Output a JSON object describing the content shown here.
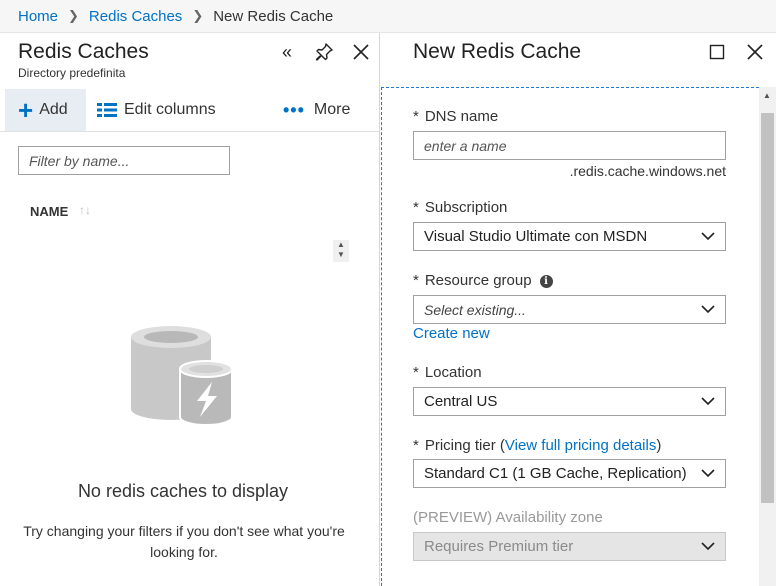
{
  "breadcrumb": {
    "items": [
      "Home",
      "Redis Caches"
    ],
    "current": "New Redis Cache"
  },
  "left_blade": {
    "title": "Redis Caches",
    "subtitle": "Directory predefinita",
    "toolbar": {
      "add_label": "Add",
      "edit_columns_label": "Edit columns",
      "more_label": "More"
    },
    "filter_placeholder": "Filter by name...",
    "column_header": "NAME",
    "empty_title": "No redis caches to display",
    "empty_subtitle": "Try changing your filters if you don't see what you're looking for."
  },
  "right_blade": {
    "title": "New Redis Cache",
    "dns": {
      "label": "DNS name",
      "placeholder": "enter a name",
      "suffix": ".redis.cache.windows.net"
    },
    "subscription": {
      "label": "Subscription",
      "value": "Visual Studio Ultimate con MSDN"
    },
    "resource_group": {
      "label": "Resource group",
      "placeholder": "Select existing...",
      "create_new": "Create new"
    },
    "location": {
      "label": "Location",
      "value": "Central US"
    },
    "pricing_tier": {
      "label": "Pricing tier",
      "paren_open": "(",
      "link": "View full pricing details",
      "paren_close": ")",
      "value": "Standard C1 (1 GB Cache, Replication)"
    },
    "availability_zone": {
      "label": "(PREVIEW) Availability zone",
      "value": "Requires Premium tier"
    },
    "required_marker": "*"
  },
  "colors": {
    "accent": "#0072c6",
    "focus_border": "#1f7ad8",
    "add_button_bg": "#e8edf3"
  }
}
